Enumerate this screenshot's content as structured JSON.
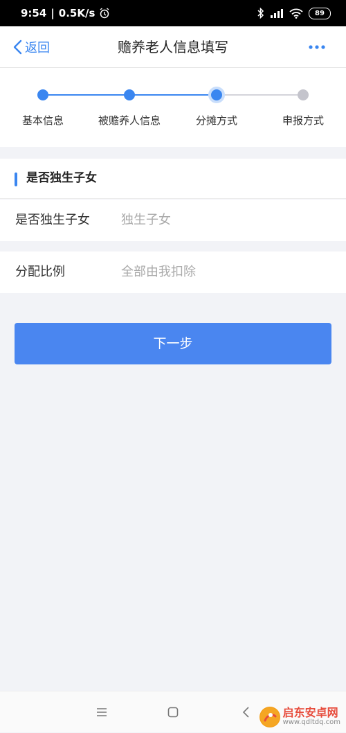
{
  "status_bar": {
    "time": "9:54",
    "speed": "0.5K/s",
    "battery": "89",
    "icons": [
      "alarm-icon",
      "bluetooth-icon",
      "signal-icon",
      "wifi-icon",
      "battery-icon"
    ]
  },
  "nav": {
    "back_label": "返回",
    "title": "赡养老人信息填写",
    "more_icon": "more-dots-icon"
  },
  "steps": [
    {
      "label": "基本信息",
      "state": "done"
    },
    {
      "label": "被赡养人信息",
      "state": "done"
    },
    {
      "label": "分摊方式",
      "state": "current"
    },
    {
      "label": "申报方式",
      "state": "pending"
    }
  ],
  "section": {
    "title": "是否独生子女"
  },
  "form": {
    "only_child": {
      "label": "是否独生子女",
      "value": "独生子女"
    },
    "ratio": {
      "label": "分配比例",
      "value": "全部由我扣除"
    }
  },
  "next_button": "下一步",
  "watermark": {
    "name": "启东安卓网",
    "url": "www.qdltdq.com"
  },
  "colors": {
    "accent": "#3a86f0",
    "button": "#4a86f0",
    "pending": "#c4c4cc",
    "background": "#f2f3f7"
  }
}
